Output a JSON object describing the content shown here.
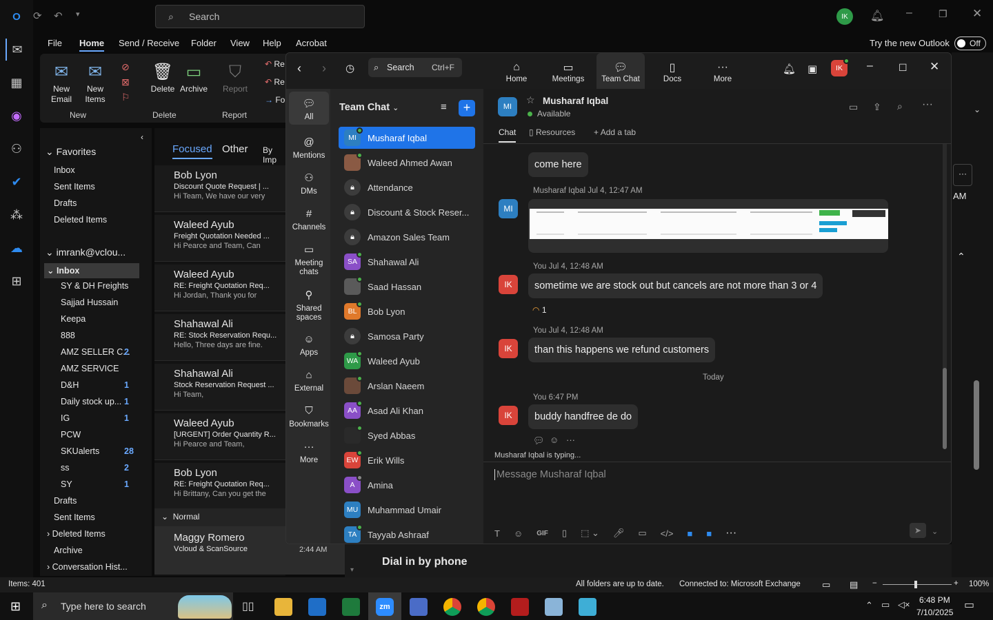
{
  "outlook": {
    "search_placeholder": "Search",
    "user_initials": "IK",
    "menu": [
      "File",
      "Home",
      "Send / Receive",
      "Folder",
      "View",
      "Help",
      "Acrobat"
    ],
    "try_new": "Try the new Outlook",
    "toggle": "Off",
    "ribbon": {
      "new_email": "New Email",
      "new_items": "New Items",
      "delete": "Delete",
      "archive": "Archive",
      "report": "Report",
      "group_new": "New",
      "group_delete": "Delete",
      "group_report": "Report",
      "re1": "Re",
      "re2": "Re",
      "fo": "Fo"
    },
    "favorites_label": "Favorites",
    "favorites": [
      "Inbox",
      "Sent Items",
      "Drafts",
      "Deleted Items"
    ],
    "account": "imrank@vclou...",
    "inbox": "Inbox",
    "subfolders": [
      {
        "name": "SY & DH Freights",
        "count": ""
      },
      {
        "name": "Sajjad Hussain",
        "count": ""
      },
      {
        "name": "Keepa",
        "count": ""
      },
      {
        "name": "888",
        "count": ""
      },
      {
        "name": "AMZ SELLER C...",
        "count": "2"
      },
      {
        "name": "AMZ SERVICE",
        "count": ""
      },
      {
        "name": "D&H",
        "count": "1"
      },
      {
        "name": "Daily stock up...",
        "count": "1"
      },
      {
        "name": "IG",
        "count": "1"
      },
      {
        "name": "PCW",
        "count": ""
      },
      {
        "name": "SKUalerts",
        "count": "28"
      },
      {
        "name": "ss",
        "count": "2"
      },
      {
        "name": "SY",
        "count": "1"
      }
    ],
    "other_folders": [
      "Drafts",
      "Sent Items",
      "Deleted Items",
      "Archive",
      "Conversation Hist..."
    ],
    "tabs": {
      "focused": "Focused",
      "other": "Other",
      "by": "By Imp"
    },
    "messages": [
      {
        "from": "Bob Lyon",
        "subject": "Discount Quote Request | ...",
        "preview": "Hi Team,  We have our very"
      },
      {
        "from": "Waleed Ayub",
        "subject": "Freight Quotation Needed ...",
        "preview": "Hi Pearce and Team,  Can"
      },
      {
        "from": "Waleed Ayub",
        "subject": "RE: Freight Quotation Req...",
        "preview": "Hi Jordan,  Thank you for"
      },
      {
        "from": "Shahawal Ali",
        "subject": "RE: Stock Reservation Requ...",
        "preview": "Hello,  Three days are fine."
      },
      {
        "from": "Shahawal Ali",
        "subject": "Stock Reservation Request ...",
        "preview": "Hi Team,"
      },
      {
        "from": "Waleed Ayub",
        "subject": "[URGENT] Order Quantity R...",
        "preview": "Hi Pearce and Team,"
      },
      {
        "from": "Bob Lyon",
        "subject": "RE: Freight Quotation Req...",
        "preview": "Hi Brittany,  Can you get the"
      }
    ],
    "normal_group": "Normal",
    "normal_msg": {
      "from": "Maggy Romero",
      "subject": "Vcloud & ScanSource",
      "time": "2:44 AM"
    },
    "reading": {
      "dial": "Dial in by phone",
      "am": "AM"
    },
    "status": {
      "items": "Items: 401",
      "sync": "All folders are up to date.",
      "connected": "Connected to: Microsoft Exchange",
      "zoom": "100%"
    }
  },
  "zoom": {
    "nav": [
      {
        "label": "Home"
      },
      {
        "label": "Meetings"
      },
      {
        "label": "Team Chat"
      },
      {
        "label": "Docs"
      },
      {
        "label": "More"
      }
    ],
    "search_label": "Search",
    "search_shortcut": "Ctrl+F",
    "user_initials": "IK",
    "rail": [
      "All",
      "Mentions",
      "DMs",
      "Channels",
      "Meeting chats",
      "Shared spaces",
      "Apps",
      "External",
      "Bookmarks",
      "More"
    ],
    "list_title": "Team Chat",
    "contacts": [
      {
        "name": "Musharaf Iqbal",
        "initials": "MI",
        "color": "#2d7fc1",
        "status": "on"
      },
      {
        "name": "Waleed Ahmed Awan",
        "initials": "",
        "color": "#8a5a44",
        "status": "on"
      },
      {
        "name": "Attendance",
        "initials": "",
        "color": "#3c3c3c",
        "status": "lock"
      },
      {
        "name": "Discount & Stock Reser...",
        "initials": "",
        "color": "#3c3c3c",
        "status": "lock"
      },
      {
        "name": "Amazon Sales Team",
        "initials": "",
        "color": "#3c3c3c",
        "status": "lock"
      },
      {
        "name": "Shahawal Ali",
        "initials": "SA",
        "color": "#8a4fc7",
        "status": "on"
      },
      {
        "name": "Saad Hassan",
        "initials": "",
        "color": "#5a5a5a",
        "status": "on"
      },
      {
        "name": "Bob Lyon",
        "initials": "BL",
        "color": "#e0792b",
        "status": "on"
      },
      {
        "name": "Samosa Party",
        "initials": "",
        "color": "#3c3c3c",
        "status": "lock"
      },
      {
        "name": "Waleed Ayub",
        "initials": "WA",
        "color": "#2e9a48",
        "status": "on"
      },
      {
        "name": "Arslan Naeem",
        "initials": "",
        "color": "#6b4a3a",
        "status": "on"
      },
      {
        "name": "Asad Ali Khan",
        "initials": "AA",
        "color": "#8a4fc7",
        "status": "on"
      },
      {
        "name": "Syed Abbas",
        "initials": "",
        "color": "#2a2a2a",
        "status": "on"
      },
      {
        "name": "Erik Wills",
        "initials": "EW",
        "color": "#d9443a",
        "status": "on"
      },
      {
        "name": "Amina",
        "initials": "A",
        "color": "#8a4fc7",
        "status": "away"
      },
      {
        "name": "Muhammad Umair",
        "initials": "MU",
        "color": "#2d7fc1",
        "status": "none"
      },
      {
        "name": "Tayyab Ashraaf",
        "initials": "TA",
        "color": "#2d7fc1",
        "status": "on"
      }
    ],
    "chat": {
      "name": "Musharaf Iqbal",
      "initials": "MI",
      "status": "Available",
      "tabs": [
        "Chat",
        "Resources",
        "Add a tab"
      ],
      "msg1": "come here",
      "meta_img": "Musharaf Iqbal Jul 4, 12:47 AM",
      "meta2": "You Jul 4, 12:48 AM",
      "msg2": "sometime we are stock out  but cancels are not more than 3 or 4",
      "reaction_count": "1",
      "meta3": "You Jul 4, 12:48 AM",
      "msg3": "than this happens we refund customers",
      "today": "Today",
      "meta4": "You 6:47 PM",
      "msg4": "buddy handfree de do",
      "typing": "Musharaf Iqbal  is typing...",
      "compose_placeholder": "Message Musharaf Iqbal",
      "gif": "GIF"
    }
  },
  "taskbar": {
    "search_placeholder": "Type here to search",
    "time": "6:48 PM",
    "date": "7/10/2025"
  }
}
